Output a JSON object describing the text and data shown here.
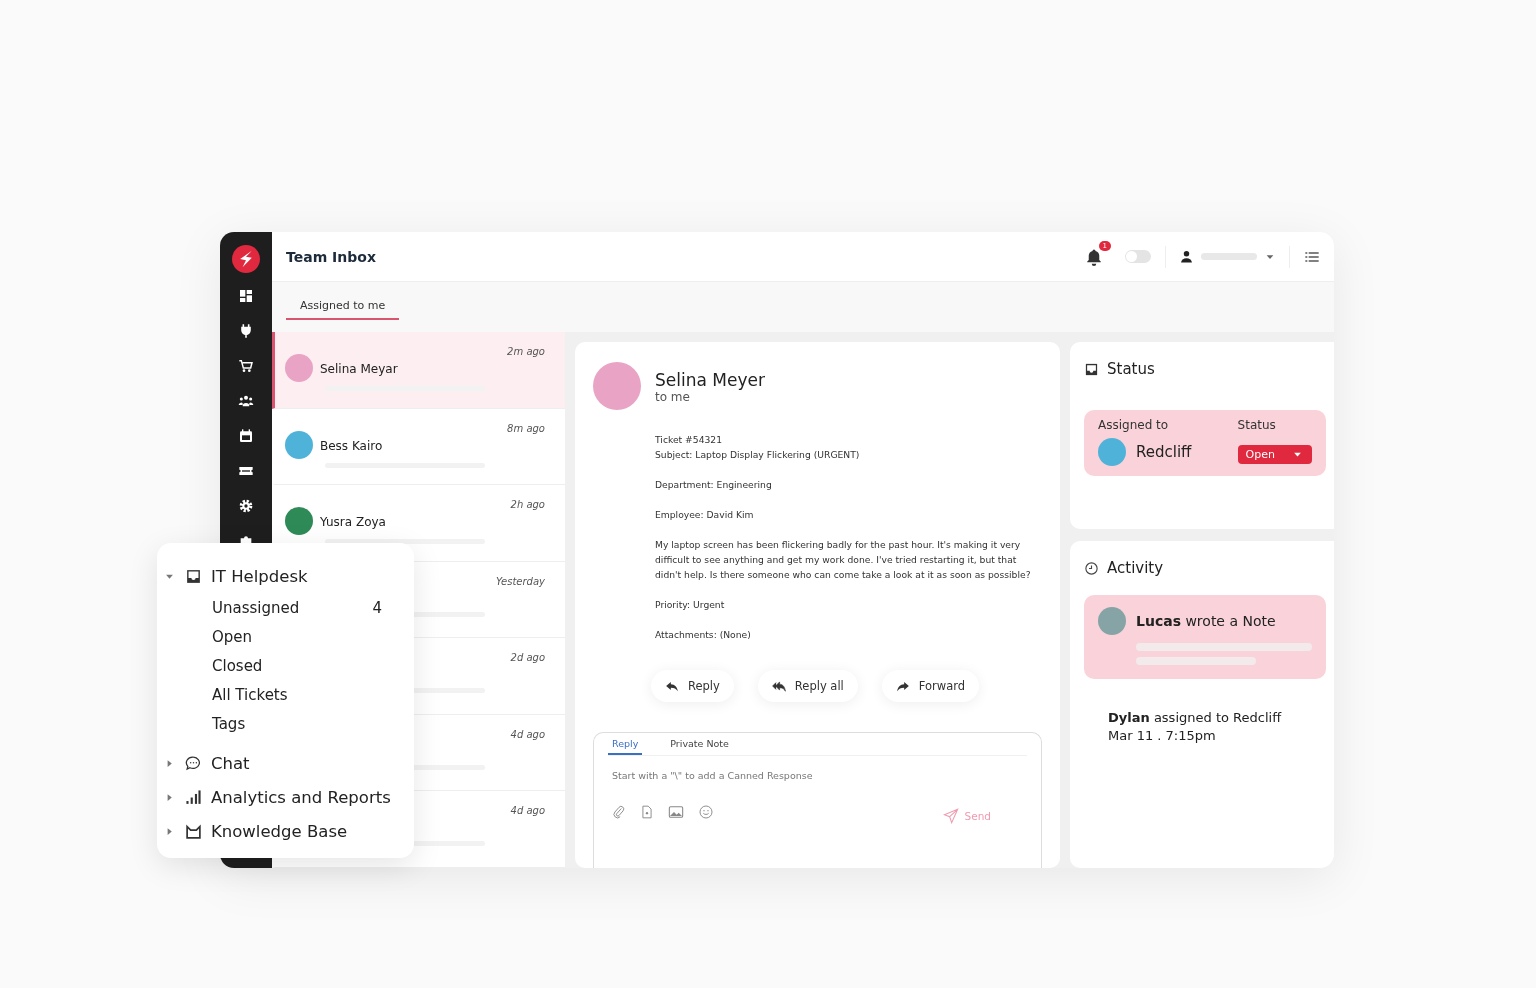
{
  "window": {
    "title": "Team Inbox"
  },
  "header": {
    "notification_count": "1",
    "toggle_on": false
  },
  "tabs": [
    {
      "label": "Assigned to me",
      "selected": true
    }
  ],
  "tickets": [
    {
      "name": "Selina Meyar",
      "time": "2m ago",
      "selected": true,
      "color": "#e9a3c4"
    },
    {
      "name": "Bess Kairo",
      "time": "8m ago",
      "selected": false,
      "color": "#4fb3d9"
    },
    {
      "name": "Yusra Zoya",
      "time": "2h ago",
      "selected": false,
      "color": "#2e8b57"
    },
    {
      "time": "Yesterday",
      "selected": false
    },
    {
      "time": "2d ago",
      "selected": false
    },
    {
      "time": "4d ago",
      "selected": false
    },
    {
      "time": "4d ago",
      "selected": false
    }
  ],
  "message": {
    "sender": "Selina Meyer",
    "recipient": "to me",
    "paragraphs": [
      [
        "Ticket #54321",
        "Subject: Laptop Display Flickering (URGENT)"
      ],
      [
        "Department: Engineering"
      ],
      [
        "Employee: David Kim"
      ],
      [
        "My laptop screen has been flickering badly for the past hour. It's making it very difficult to see anything and get my work done. I've tried restarting it, but that didn't help. Is there someone who can come take a look at it as soon as possible?"
      ],
      [
        "Priority: Urgent"
      ],
      [
        "Attachments: (None)"
      ]
    ],
    "actions": [
      {
        "kind": "reply",
        "label": "Reply"
      },
      {
        "kind": "reply_all",
        "label": "Reply all"
      },
      {
        "kind": "forward",
        "label": "Forward"
      }
    ]
  },
  "composer": {
    "tabs": [
      {
        "label": "Reply",
        "selected": true
      },
      {
        "label": "Private Note",
        "selected": false
      }
    ],
    "placeholder": "Start with a \"\\\" to add a Canned Response",
    "send": "Send"
  },
  "status_panel": {
    "title": "Status",
    "assigned_label": "Assigned to",
    "assignee": "Redcliff",
    "status_label": "Status",
    "status_value": "Open"
  },
  "activity": {
    "title": "Activity",
    "items": [
      {
        "kind": "note",
        "text": "**Lucas** wrote a Note"
      },
      {
        "kind": "event",
        "text": "**Dylan** assigned to Redcliff",
        "time": "Mar 11 . 7:15pm"
      }
    ]
  },
  "nav_menu": {
    "items": [
      {
        "kind": "inbox",
        "label": "IT Helpdesk",
        "expanded": true,
        "children": [
          {
            "label": "Unassigned",
            "count": "4"
          },
          {
            "label": "Open"
          },
          {
            "label": "Closed"
          },
          {
            "label": "All Tickets"
          },
          {
            "label": "Tags"
          }
        ]
      },
      {
        "kind": "chat",
        "label": "Chat",
        "expanded": false
      },
      {
        "kind": "chart",
        "label": "Analytics and Reports",
        "expanded": false
      },
      {
        "kind": "book",
        "label": "Knowledge Base",
        "expanded": false
      }
    ]
  }
}
